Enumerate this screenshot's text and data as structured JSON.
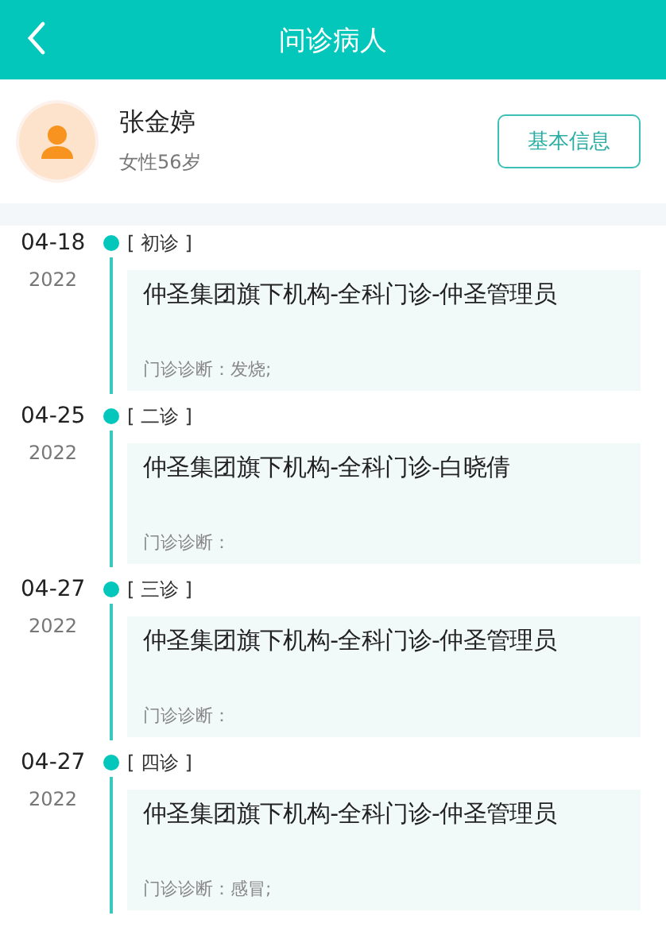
{
  "header": {
    "title": "问诊病人"
  },
  "patient": {
    "name": "张金婷",
    "info": "女性56岁",
    "button": "基本信息"
  },
  "visits": [
    {
      "date": "04-18",
      "year": "2022",
      "tag": "[ 初诊 ]",
      "title": "仲圣集团旗下机构-全科门诊-仲圣管理员",
      "diagnosis": "门诊诊断：发烧;"
    },
    {
      "date": "04-25",
      "year": "2022",
      "tag": "[ 二诊 ]",
      "title": "仲圣集团旗下机构-全科门诊-白晓倩",
      "diagnosis": "门诊诊断："
    },
    {
      "date": "04-27",
      "year": "2022",
      "tag": "[ 三诊 ]",
      "title": "仲圣集团旗下机构-全科门诊-仲圣管理员",
      "diagnosis": "门诊诊断："
    },
    {
      "date": "04-27",
      "year": "2022",
      "tag": "[ 四诊 ]",
      "title": "仲圣集团旗下机构-全科门诊-仲圣管理员",
      "diagnosis": "门诊诊断：感冒;"
    }
  ]
}
